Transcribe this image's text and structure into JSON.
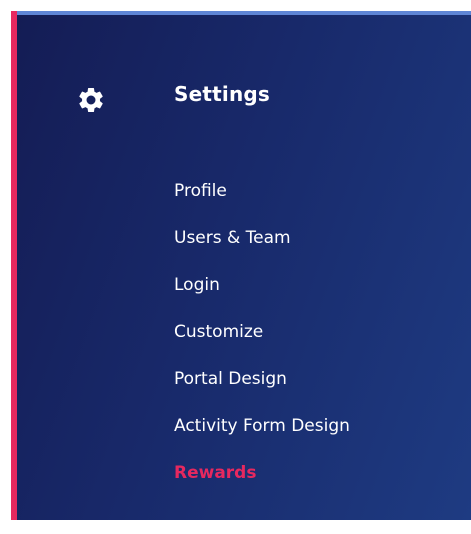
{
  "settings": {
    "icon": "gear-icon",
    "title": "Settings",
    "items": [
      {
        "label": "Profile",
        "active": false
      },
      {
        "label": "Users & Team",
        "active": false
      },
      {
        "label": "Login",
        "active": false
      },
      {
        "label": "Customize",
        "active": false
      },
      {
        "label": "Portal Design",
        "active": false
      },
      {
        "label": "Activity Form Design",
        "active": false
      },
      {
        "label": "Rewards",
        "active": true
      }
    ]
  },
  "colors": {
    "panel_background": "#18296a",
    "accent": "#e6285f",
    "text": "#ffffff"
  }
}
